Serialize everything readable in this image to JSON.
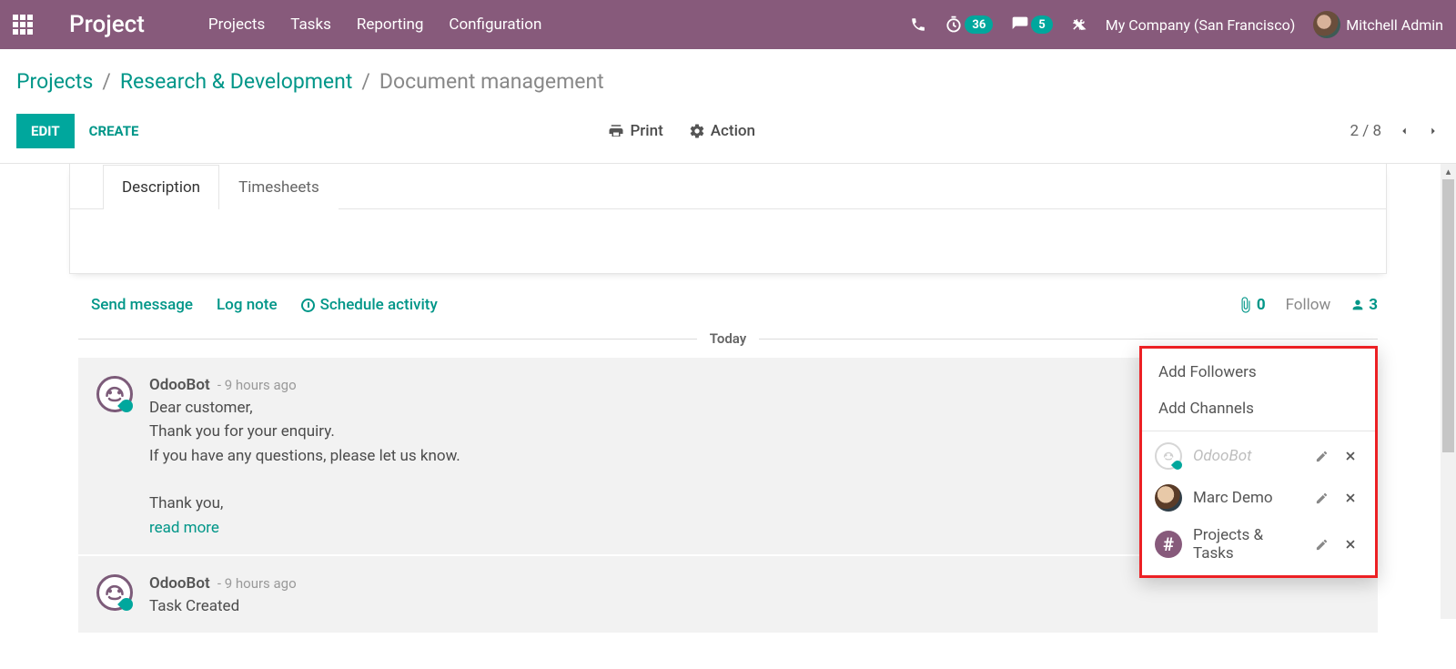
{
  "header": {
    "brand": "Project",
    "nav": [
      "Projects",
      "Tasks",
      "Reporting",
      "Configuration"
    ],
    "timer_badge": "36",
    "chat_badge": "5",
    "company": "My Company (San Francisco)",
    "user": "Mitchell Admin"
  },
  "breadcrumb": {
    "items": [
      "Projects",
      "Research & Development"
    ],
    "current": "Document management"
  },
  "buttons": {
    "edit": "EDIT",
    "create": "CREATE",
    "print": "Print",
    "action": "Action"
  },
  "pager": {
    "text": "2 / 8"
  },
  "tabs": {
    "description": "Description",
    "timesheets": "Timesheets"
  },
  "msgbar": {
    "send": "Send message",
    "log": "Log note",
    "schedule": "Schedule activity",
    "attachments": "0",
    "follow": "Follow",
    "followers": "3"
  },
  "timeline": {
    "today": "Today"
  },
  "messages": [
    {
      "author": "OdooBot",
      "time": "- 9 hours ago",
      "lines": [
        "Dear customer,",
        "Thank you for your enquiry.",
        "If you have any questions, please let us know.",
        "",
        "Thank you,"
      ],
      "readmore": "read more"
    },
    {
      "author": "OdooBot",
      "time": "- 9 hours ago",
      "lines": [
        "Task Created"
      ]
    }
  ],
  "popover": {
    "add_followers": "Add Followers",
    "add_channels": "Add Channels",
    "rows": [
      {
        "name": "OdooBot",
        "muted": true,
        "avatar": "bot"
      },
      {
        "name": "Marc Demo",
        "muted": false,
        "avatar": "person"
      },
      {
        "name": "Projects & Tasks",
        "muted": false,
        "avatar": "channel"
      }
    ]
  }
}
